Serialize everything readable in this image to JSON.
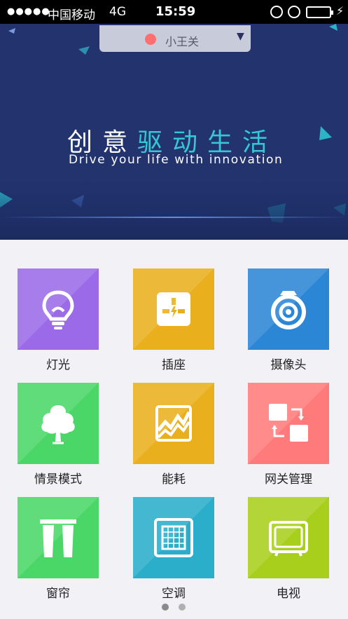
{
  "status_bar": {
    "signal": "●●●●●",
    "carrier": "中国移动",
    "network": "4G",
    "time": "15:59",
    "battery_level": 0.85,
    "battery_color": "#4cd964"
  },
  "header": {
    "gateway_name": "小王关",
    "gateway_status_color": "#ff6f6f",
    "slogan_cn_white": "创意",
    "slogan_cn_accent": "驱动生活",
    "slogan_en": "Drive your life with innovation",
    "accent_color": "#36c6d6",
    "background_color": "#22336e"
  },
  "tiles": [
    {
      "label": "灯光",
      "color": "#9b6ae8",
      "icon": "bulb-icon"
    },
    {
      "label": "插座",
      "color": "#e9af1d",
      "icon": "socket-icon"
    },
    {
      "label": "摄像头",
      "color": "#2c86d6",
      "icon": "camera-icon"
    },
    {
      "label": "情景模式",
      "color": "#4ad768",
      "icon": "tree-icon"
    },
    {
      "label": "能耗",
      "color": "#e9af1d",
      "icon": "energy-chart-icon"
    },
    {
      "label": "网关管理",
      "color": "#ff7b7b",
      "icon": "gateway-icon"
    },
    {
      "label": "窗帘",
      "color": "#4ad768",
      "icon": "curtain-icon"
    },
    {
      "label": "空调",
      "color": "#2aaec9",
      "icon": "air-conditioner-icon"
    },
    {
      "label": "电视",
      "color": "#a9cf1d",
      "icon": "tv-icon"
    }
  ],
  "pager": {
    "pages": 2,
    "current": 1
  }
}
